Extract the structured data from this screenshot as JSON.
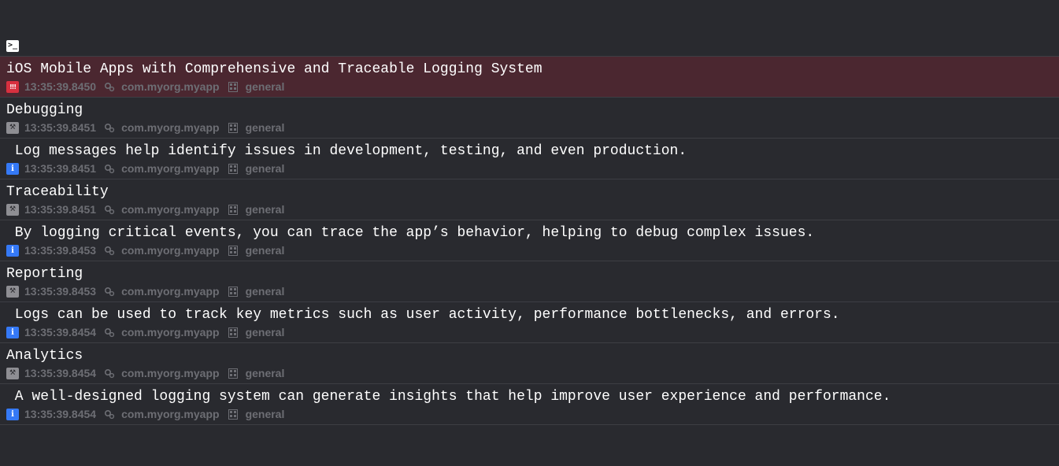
{
  "console": {
    "terminal_icon_glyph": ">_"
  },
  "entries": [
    {
      "message": "iOS Mobile Apps with Comprehensive and Traceable Logging System",
      "type": "fault",
      "type_glyph": "!!!",
      "timestamp": "13:35:39.8450",
      "subsystem": "com.myorg.myapp",
      "category": "general"
    },
    {
      "message": "Debugging",
      "type": "debug",
      "type_glyph": "⚒",
      "timestamp": "13:35:39.8451",
      "subsystem": "com.myorg.myapp",
      "category": "general"
    },
    {
      "message": " Log messages help identify issues in development, testing, and even production.",
      "type": "info",
      "type_glyph": "i",
      "timestamp": "13:35:39.8451",
      "subsystem": "com.myorg.myapp",
      "category": "general"
    },
    {
      "message": "Traceability",
      "type": "debug",
      "type_glyph": "⚒",
      "timestamp": "13:35:39.8451",
      "subsystem": "com.myorg.myapp",
      "category": "general"
    },
    {
      "message": " By logging critical events, you can trace the app’s behavior, helping to debug complex issues.",
      "type": "info",
      "type_glyph": "i",
      "timestamp": "13:35:39.8453",
      "subsystem": "com.myorg.myapp",
      "category": "general"
    },
    {
      "message": "Reporting",
      "type": "debug",
      "type_glyph": "⚒",
      "timestamp": "13:35:39.8453",
      "subsystem": "com.myorg.myapp",
      "category": "general"
    },
    {
      "message": " Logs can be used to track key metrics such as user activity, performance bottlenecks, and errors.",
      "type": "info",
      "type_glyph": "i",
      "timestamp": "13:35:39.8454",
      "subsystem": "com.myorg.myapp",
      "category": "general"
    },
    {
      "message": "Analytics",
      "type": "debug",
      "type_glyph": "⚒",
      "timestamp": "13:35:39.8454",
      "subsystem": "com.myorg.myapp",
      "category": "general"
    },
    {
      "message": " A well-designed logging system can generate insights that help improve user experience and performance.",
      "type": "info",
      "type_glyph": "i",
      "timestamp": "13:35:39.8454",
      "subsystem": "com.myorg.myapp",
      "category": "general"
    }
  ],
  "colors": {
    "background": "#292a2f",
    "fault_row": "#4b2730",
    "separator": "#3d3e44",
    "meta_text": "#6d6e74",
    "fault_icon": "#d8303f",
    "debug_icon": "#8e8e93",
    "info_icon": "#3579f6"
  }
}
